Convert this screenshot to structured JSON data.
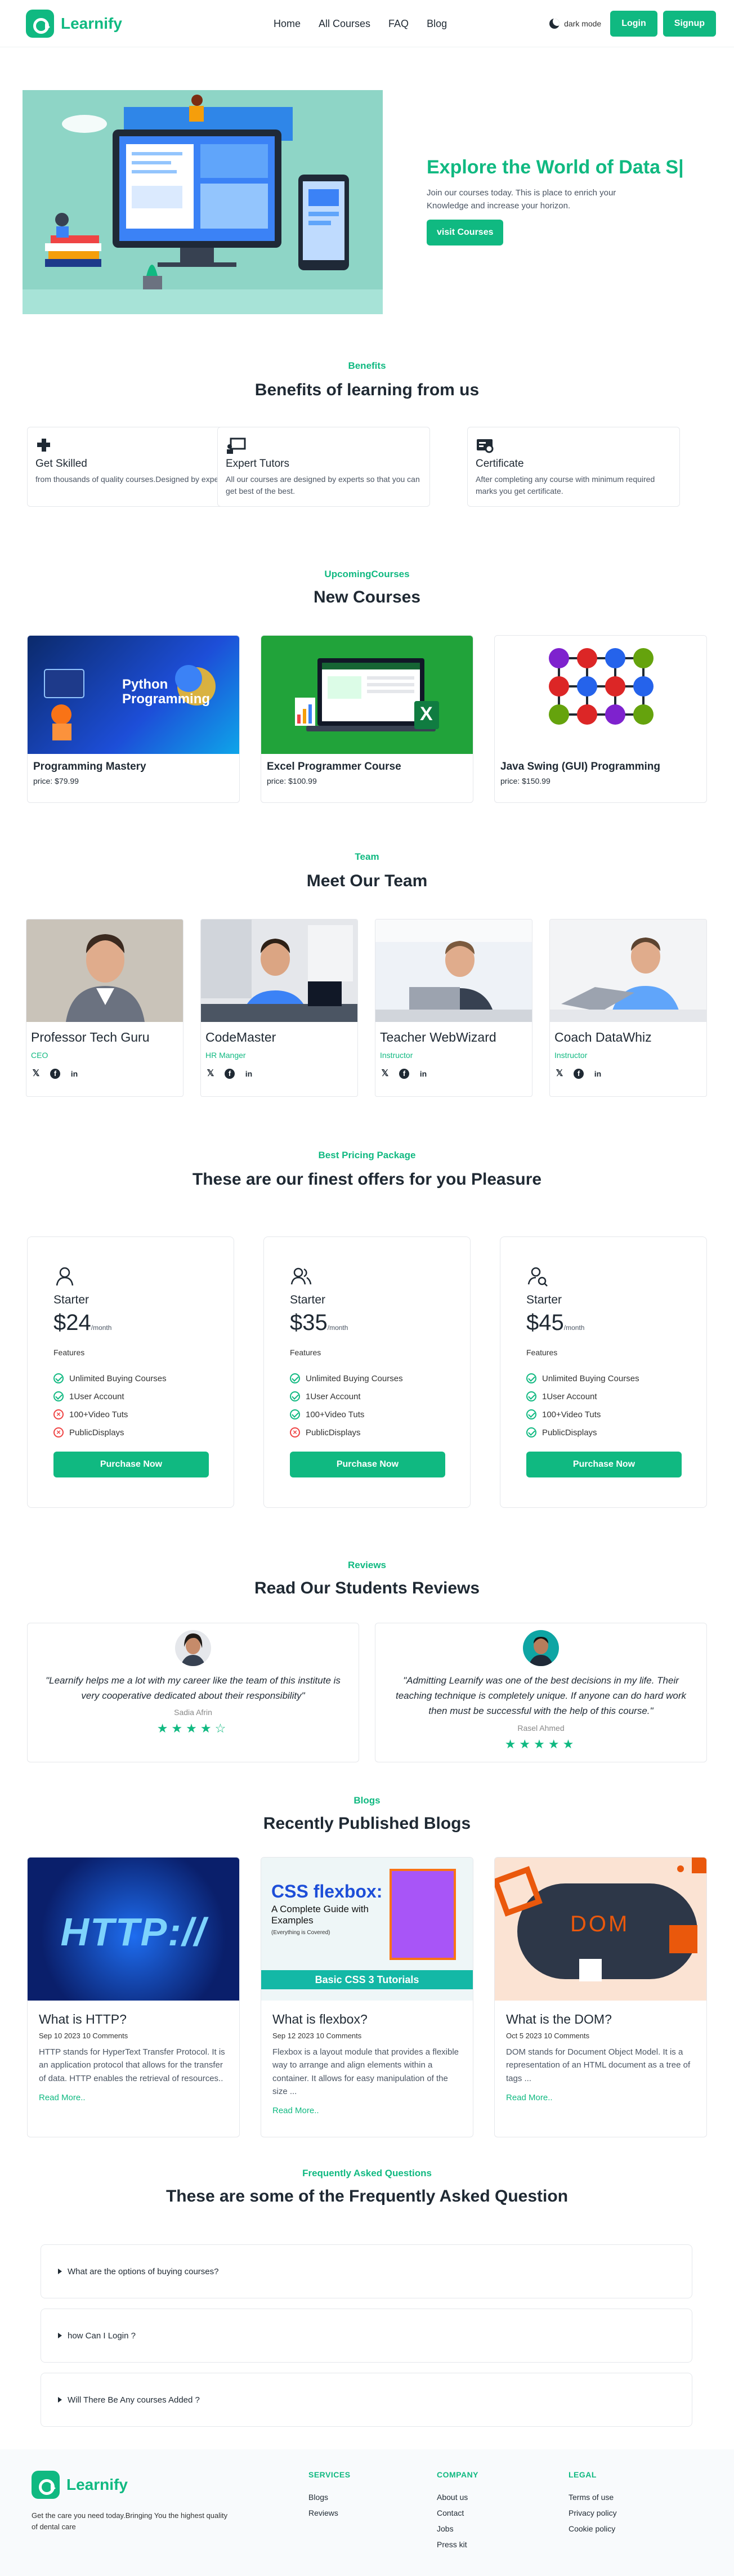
{
  "brand": {
    "name": "Learnify",
    "color": "#10b981"
  },
  "nav": {
    "links": [
      "Home",
      "All Courses",
      "FAQ",
      "Blog"
    ],
    "dark_mode_label": "dark mode",
    "login": "Login",
    "signup": "Signup"
  },
  "hero": {
    "title": "Explore the World of Data S|",
    "subtitle": "Join our courses today. This is place to enrich your Knowledge and increase your horizon.",
    "cta": "visit Courses"
  },
  "benefits": {
    "kicker": "Benefits",
    "title": "Benefits of learning from us",
    "items": [
      {
        "icon": "puzzle-icon",
        "title": "Get Skilled",
        "text": "from thousands of quality courses.Designed by experts"
      },
      {
        "icon": "tutor-board-icon",
        "title": "Expert Tutors",
        "text": "All our courses are designed by experts so that you can get best of the best."
      },
      {
        "icon": "certificate-icon",
        "title": "Certificate",
        "text": "After completing any course with minimum required marks you get certificate."
      }
    ]
  },
  "courses": {
    "kicker": "UpcomingCourses",
    "title": "New Courses",
    "items": [
      {
        "title": "Programming Mastery",
        "price": "price: $79.99",
        "image_text": "Python Programming"
      },
      {
        "title": "Excel Programmer Course",
        "price": "price: $100.99",
        "image_text": "X"
      },
      {
        "title": "Java Swing (GUI) Programming",
        "price": "price: $150.99",
        "image_text": ""
      }
    ]
  },
  "team": {
    "kicker": "Team",
    "title": "Meet Our Team",
    "members": [
      {
        "name": "Professor Tech Guru",
        "role": "CEO"
      },
      {
        "name": "CodeMaster",
        "role": "HR Manger"
      },
      {
        "name": "Teacher WebWizard",
        "role": "Instructor"
      },
      {
        "name": "Coach DataWhiz",
        "role": "Instructor"
      }
    ]
  },
  "pricing": {
    "kicker": "Best Pricing Package",
    "title": "These are our finest offers for you Pleasure",
    "plans": [
      {
        "name": "Starter",
        "price": "$24",
        "period": "/month",
        "features_label": "Features",
        "features": [
          {
            "text": "Unlimited Buying Courses",
            "ok": true
          },
          {
            "text": "1User Account",
            "ok": true
          },
          {
            "text": "100+Video Tuts",
            "ok": false
          },
          {
            "text": "PublicDisplays",
            "ok": false
          }
        ],
        "button": "Purchase Now"
      },
      {
        "name": "Starter",
        "price": "$35",
        "period": "/month",
        "features_label": "Features",
        "features": [
          {
            "text": "Unlimited Buying Courses",
            "ok": true
          },
          {
            "text": "1User Account",
            "ok": true
          },
          {
            "text": "100+Video Tuts",
            "ok": true
          },
          {
            "text": "PublicDisplays",
            "ok": false
          }
        ],
        "button": "Purchase Now"
      },
      {
        "name": "Starter",
        "price": "$45",
        "period": "/month",
        "features_label": "Features",
        "features": [
          {
            "text": "Unlimited Buying Courses",
            "ok": true
          },
          {
            "text": "1User Account",
            "ok": true
          },
          {
            "text": "100+Video Tuts",
            "ok": true
          },
          {
            "text": "PublicDisplays",
            "ok": true
          }
        ],
        "button": "Purchase Now"
      }
    ]
  },
  "reviews": {
    "kicker": "Reviews",
    "title": "Read Our Students Reviews",
    "items": [
      {
        "quote": "\"Learnify helps me a lot with my career like the team of this institute is very cooperative dedicated about their responsibility\"",
        "author": "Sadia Afrin",
        "stars": "★★★★☆"
      },
      {
        "quote": "\"Admitting Learnify was one of the best decisions in my life. Their teaching technique is completely unique. If anyone can do hard work then must be successful with the help of this course.\"",
        "author": "Rasel Ahmed",
        "stars": "★★★★★"
      }
    ]
  },
  "blogs": {
    "kicker": "Blogs",
    "title": "Recently Published Blogs",
    "items": [
      {
        "title": "What is HTTP?",
        "meta": "Sep 10 2023 10 Comments",
        "text": "HTTP stands for HyperText Transfer Protocol. It is an application protocol that allows for the transfer of data. HTTP enables the retrieval of resources..",
        "more": "Read More..",
        "image_text": "HTTP://"
      },
      {
        "title": "What is flexbox?",
        "meta": "Sep 12 2023 10 Comments",
        "text": "Flexbox is a layout module that provides a flexible way to arrange and align elements within a container. It allows for easy manipulation of the size ...",
        "more": "Read More..",
        "image_text": "CSS flexbox:",
        "image_sub": "A Complete Guide with Examples",
        "image_sub2": "(Everything is Covered)",
        "image_band": "Basic CSS 3 Tutorials"
      },
      {
        "title": "What is the DOM?",
        "meta": "Oct 5 2023 10 Comments",
        "text": "DOM stands for Document Object Model. It is a representation of an HTML document as a tree of tags ...",
        "more": "Read More..",
        "image_text": "DOM"
      }
    ]
  },
  "faq": {
    "kicker": "Frequently Asked Questions",
    "title": "These are some of the Frequently Asked Question",
    "items": [
      "What are the options of buying courses?",
      "how Can I Login ?",
      "Will There Be Any courses Added ?"
    ]
  },
  "footer": {
    "tagline": "Get the care you need today.Bringing You the highest quality of dental care",
    "services": {
      "heading": "SERVICES",
      "links": [
        "Blogs",
        "Reviews"
      ]
    },
    "company": {
      "heading": "COMPANY",
      "links": [
        "About us",
        "Contact",
        "Jobs",
        "Press kit"
      ]
    },
    "legal": {
      "heading": "LEGAL",
      "links": [
        "Terms of use",
        "Privacy policy",
        "Cookie policy"
      ]
    }
  }
}
